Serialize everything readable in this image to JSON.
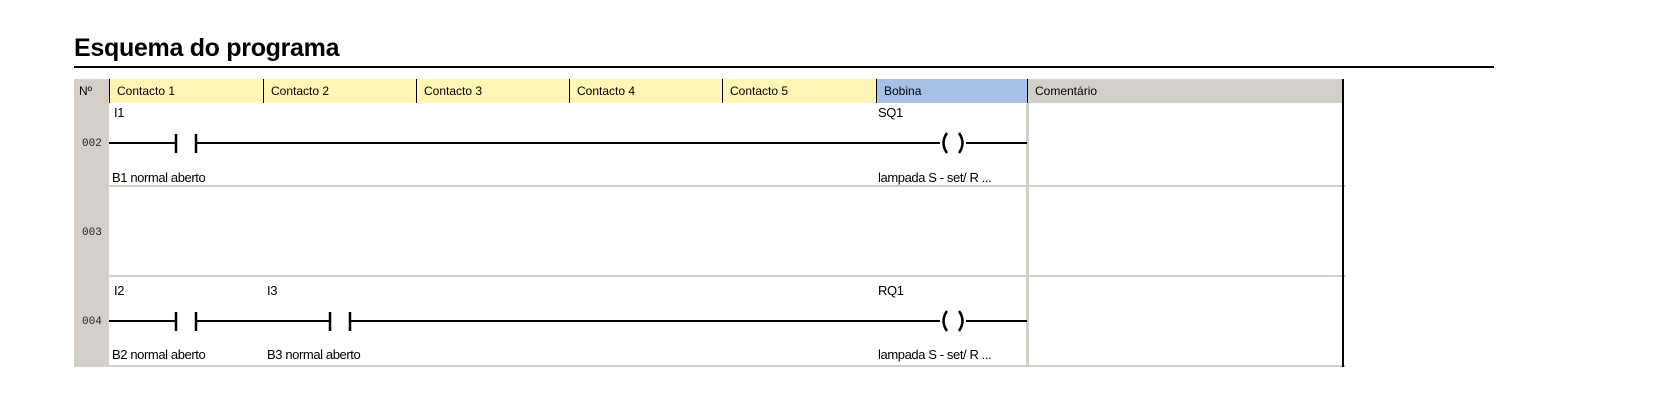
{
  "page": {
    "title": "Esquema do programa"
  },
  "table": {
    "headers": {
      "num": "Nº",
      "contact_1": "Contacto 1",
      "contact_2": "Contacto 2",
      "contact_3": "Contacto 3",
      "contact_4": "Contacto 4",
      "contact_5": "Contacto 5",
      "coil": "Bobina",
      "comment": "Comentário"
    },
    "colors": {
      "contact_header": "#fff5b4",
      "coil_header": "#a7c1e6",
      "grey_header": "#d4d0c8"
    },
    "rows": [
      {
        "number": "002",
        "contact_1": {
          "address": "I1",
          "description": "B1 normal aberto"
        },
        "coil": {
          "address": "SQ1",
          "description": "lampada  S - set/ R ..."
        },
        "comment": ""
      },
      {
        "number": "003",
        "comment": ""
      },
      {
        "number": "004",
        "contact_1": {
          "address": "I2",
          "description": "B2 normal aberto"
        },
        "contact_2": {
          "address": "I3",
          "description": "B3 normal aberto"
        },
        "coil": {
          "address": "RQ1",
          "description": "lampada  S - set/ R ..."
        },
        "comment": ""
      }
    ]
  }
}
